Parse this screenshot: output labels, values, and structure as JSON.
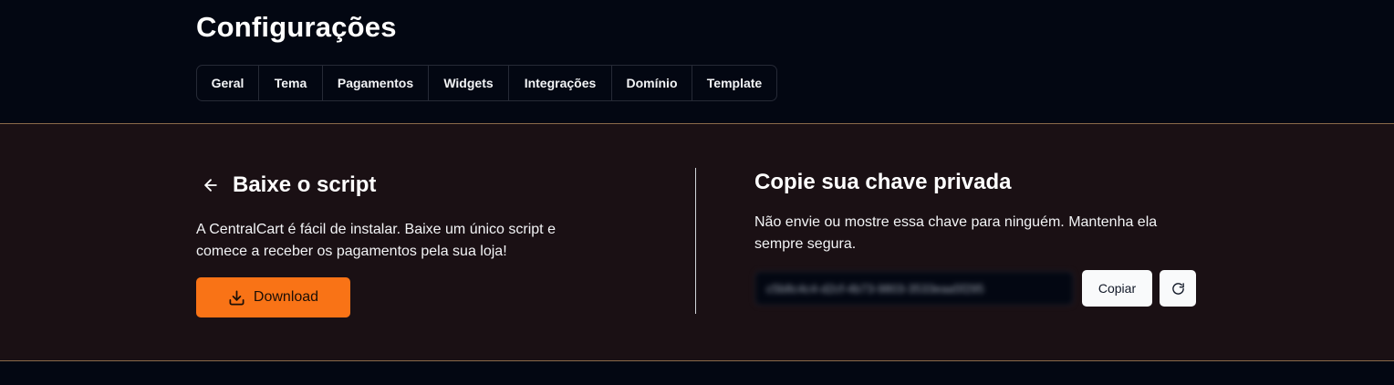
{
  "header": {
    "title": "Configurações"
  },
  "tabs": [
    {
      "label": "Geral"
    },
    {
      "label": "Tema"
    },
    {
      "label": "Pagamentos"
    },
    {
      "label": "Widgets"
    },
    {
      "label": "Integrações"
    },
    {
      "label": "Domínio"
    },
    {
      "label": "Template"
    }
  ],
  "script_section": {
    "heading": "Baixe o script",
    "description": "A CentralCart é fácil de instalar. Baixe um único script e comece a receber os pagamentos pela sua loja!",
    "download_label": "Download",
    "back_icon": "arrow-left-icon",
    "download_icon": "download-icon"
  },
  "key_section": {
    "heading": "Copie sua chave privada",
    "description": "Não envie ou mostre essa chave para ninguém. Mantenha ela sempre segura.",
    "key_value": "c5b8c4c4-d2cf-4b73-9803-3533eaa5f295",
    "copy_label": "Copiar",
    "refresh_icon": "refresh-icon"
  },
  "colors": {
    "accent": "#f97316",
    "background": "#030712",
    "band": "#1a1014"
  }
}
